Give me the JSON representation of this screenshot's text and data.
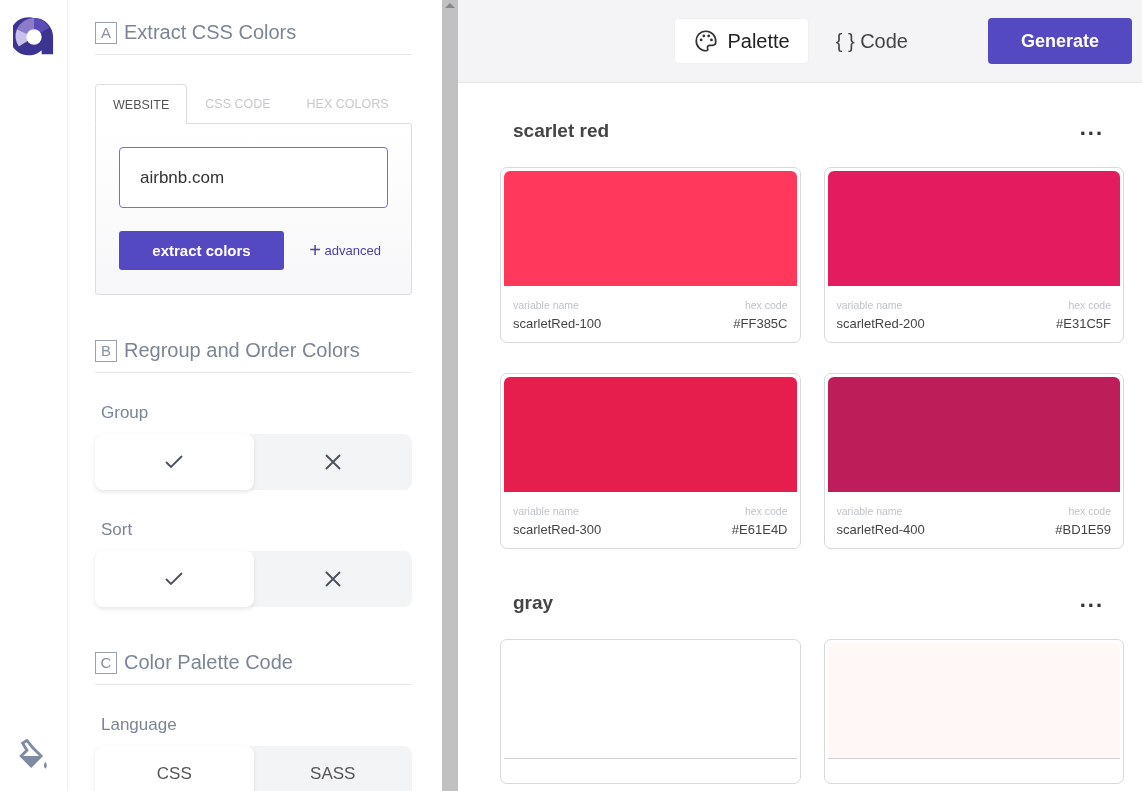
{
  "sections": [
    {
      "letter": "A",
      "title": "Extract CSS Colors",
      "kind": "extract",
      "tabs": [
        {
          "label": "WEBSITE",
          "selected": true
        },
        {
          "label": "CSS CODE",
          "selected": false
        },
        {
          "label": "HEX COLORS",
          "selected": false
        }
      ],
      "url_field": {
        "value": "airbnb.com"
      },
      "extract_button": "extract colors",
      "advanced_link": {
        "icon": "+",
        "label": "advanced"
      }
    },
    {
      "letter": "B",
      "title": "Regroup and Order Colors",
      "kind": "toggles",
      "toggles": [
        {
          "label": "Group",
          "options": [
            {
              "kind": "check",
              "selected": true
            },
            {
              "kind": "cross",
              "selected": false
            }
          ]
        },
        {
          "label": "Sort",
          "options": [
            {
              "kind": "check",
              "selected": true
            },
            {
              "kind": "cross",
              "selected": false
            }
          ]
        }
      ]
    },
    {
      "letter": "C",
      "title": "Color Palette Code",
      "kind": "toggles",
      "toggles": [
        {
          "label": "Language",
          "options": [
            {
              "kind": "text",
              "label": "CSS",
              "selected": true
            },
            {
              "kind": "text",
              "label": "SASS",
              "selected": false
            }
          ]
        }
      ]
    }
  ],
  "view_tabs": [
    {
      "kind": "palette",
      "label": "Palette",
      "selected": true
    },
    {
      "kind": "code",
      "label": "{ } Code",
      "selected": false
    }
  ],
  "generate_button": "Generate",
  "groups": [
    {
      "name": "scarlet red",
      "menu": "...",
      "swatches": [
        {
          "color": "#ff385c",
          "name_label": "variable name",
          "name": "scarletRed-100",
          "hex_label": "hex code",
          "hex": "#FF385C"
        },
        {
          "color": "#e31c5f",
          "name_label": "variable name",
          "name": "scarletRed-200",
          "hex_label": "hex code",
          "hex": "#E31C5F"
        },
        {
          "color": "#e61e4d",
          "name_label": "variable name",
          "name": "scarletRed-300",
          "hex_label": "hex code",
          "hex": "#E61E4D"
        },
        {
          "color": "#bd1e59",
          "name_label": "variable name",
          "name": "scarletRed-400",
          "hex_label": "hex code",
          "hex": "#BD1E59"
        }
      ]
    },
    {
      "name": "gray",
      "menu": "...",
      "swatches": [
        {
          "color": "#ffffff"
        },
        {
          "color": "#fff8f7"
        }
      ]
    }
  ]
}
